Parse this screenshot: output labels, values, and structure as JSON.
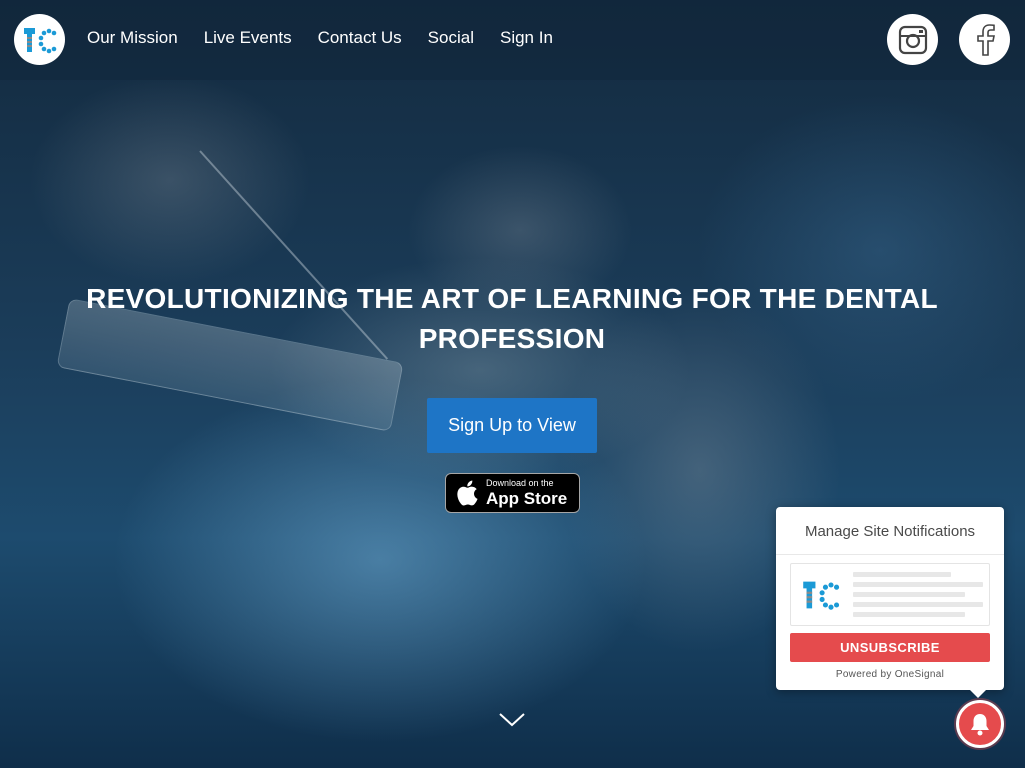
{
  "nav": {
    "items": [
      {
        "label": "Our Mission"
      },
      {
        "label": "Live Events"
      },
      {
        "label": "Contact Us"
      },
      {
        "label": "Social"
      },
      {
        "label": "Sign In"
      }
    ]
  },
  "social": {
    "icons": [
      "instagram-icon",
      "facebook-icon"
    ]
  },
  "hero": {
    "headline": "REVOLUTIONIZING THE ART OF LEARNING FOR THE DENTAL PROFESSION",
    "cta_label": "Sign Up to View",
    "appstore_small": "Download on the",
    "appstore_big": "App Store"
  },
  "notifications": {
    "title": "Manage Site Notifications",
    "unsubscribe_label": "UNSUBSCRIBE",
    "powered_by": "Powered by OneSignal"
  },
  "colors": {
    "cta": "#1e75c6",
    "unsubscribe": "#e54b4d",
    "logo_blue": "#1b9ad6"
  }
}
